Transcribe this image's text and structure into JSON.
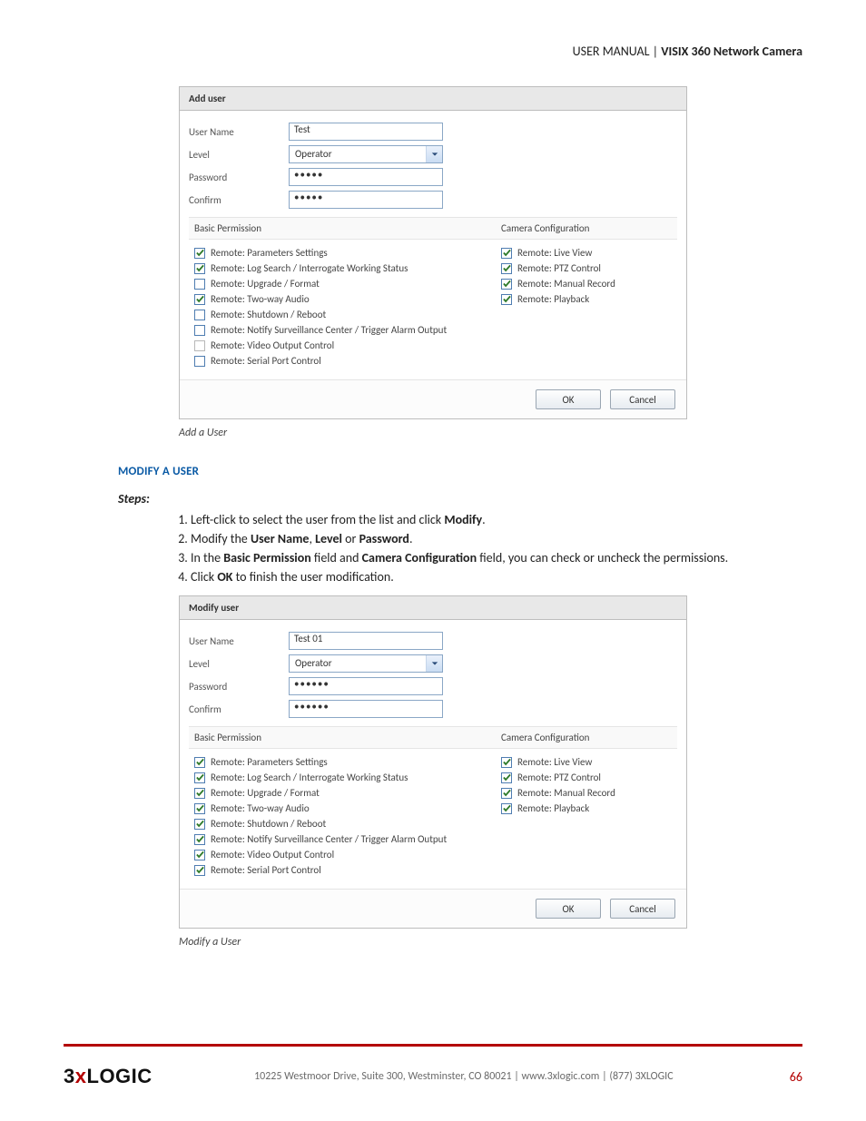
{
  "doc_header": {
    "prefix": "USER MANUAL | ",
    "product": "VISIX 360 Network Camera"
  },
  "dialog_add": {
    "title": "Add user",
    "fields": {
      "username_label": "User Name",
      "username_value": "Test",
      "level_label": "Level",
      "level_value": "Operator",
      "password_label": "Password",
      "password_value": "•••••",
      "confirm_label": "Confirm",
      "confirm_value": "•••••"
    },
    "perm_headers": {
      "left": "Basic Permission",
      "right": "Camera Configuration"
    },
    "perm_left": [
      {
        "label": "Remote: Parameters Settings",
        "checked": true
      },
      {
        "label": "Remote: Log Search / Interrogate Working Status",
        "checked": true
      },
      {
        "label": "Remote: Upgrade / Format",
        "checked": false
      },
      {
        "label": "Remote: Two-way Audio",
        "checked": true
      },
      {
        "label": "Remote: Shutdown / Reboot",
        "checked": false
      },
      {
        "label": "Remote: Notify Surveillance Center / Trigger Alarm Output",
        "checked": false
      },
      {
        "label": "Remote: Video Output Control",
        "checked": false,
        "disabled": true
      },
      {
        "label": "Remote: Serial Port Control",
        "checked": false
      }
    ],
    "perm_right": [
      {
        "label": "Remote: Live View",
        "checked": true
      },
      {
        "label": "Remote: PTZ Control",
        "checked": true
      },
      {
        "label": "Remote: Manual Record",
        "checked": true
      },
      {
        "label": "Remote: Playback",
        "checked": true
      }
    ],
    "ok": "OK",
    "cancel": "Cancel",
    "caption": "Add a User"
  },
  "section_heading": "MODIFY A USER",
  "steps_label": "Steps:",
  "steps": [
    {
      "pre": "Left-click to select the user from the list and click ",
      "b": "Modify",
      "post": "."
    },
    {
      "pre": "Modify the ",
      "b": "User Name",
      "mid1": ", ",
      "b2": "Level",
      "mid2": " or ",
      "b3": "Password",
      "post": "."
    },
    {
      "pre": "In the ",
      "b": "Basic Permission",
      "mid1": " field and ",
      "b2": "Camera Configuration",
      "post": " field, you can check or uncheck the permissions."
    },
    {
      "pre": "Click ",
      "b": "OK",
      "post": " to finish the user modification."
    }
  ],
  "dialog_modify": {
    "title": "Modify user",
    "fields": {
      "username_label": "User Name",
      "username_value": "Test 01",
      "level_label": "Level",
      "level_value": "Operator",
      "password_label": "Password",
      "password_value": "••••••",
      "confirm_label": "Confirm",
      "confirm_value": "••••••"
    },
    "perm_headers": {
      "left": "Basic Permission",
      "right": "Camera Configuration"
    },
    "perm_left": [
      {
        "label": "Remote: Parameters Settings",
        "checked": true
      },
      {
        "label": "Remote: Log Search / Interrogate Working Status",
        "checked": true
      },
      {
        "label": "Remote: Upgrade / Format",
        "checked": true
      },
      {
        "label": "Remote: Two-way Audio",
        "checked": true
      },
      {
        "label": "Remote: Shutdown / Reboot",
        "checked": true
      },
      {
        "label": "Remote: Notify Surveillance Center / Trigger Alarm Output",
        "checked": true
      },
      {
        "label": "Remote: Video Output Control",
        "checked": true
      },
      {
        "label": "Remote: Serial Port Control",
        "checked": true
      }
    ],
    "perm_right": [
      {
        "label": "Remote: Live View",
        "checked": true
      },
      {
        "label": "Remote: PTZ Control",
        "checked": true
      },
      {
        "label": "Remote: Manual Record",
        "checked": true
      },
      {
        "label": "Remote: Playback",
        "checked": true
      }
    ],
    "ok": "OK",
    "cancel": "Cancel",
    "caption": "Modify a User"
  },
  "footer": {
    "logo_a": "3",
    "logo_x": "x",
    "logo_b": "LOGIC",
    "address": "10225 Westmoor Drive, Suite 300, Westminster, CO 80021 | www.3xlogic.com | (877) 3XLOGIC",
    "page": "66"
  }
}
